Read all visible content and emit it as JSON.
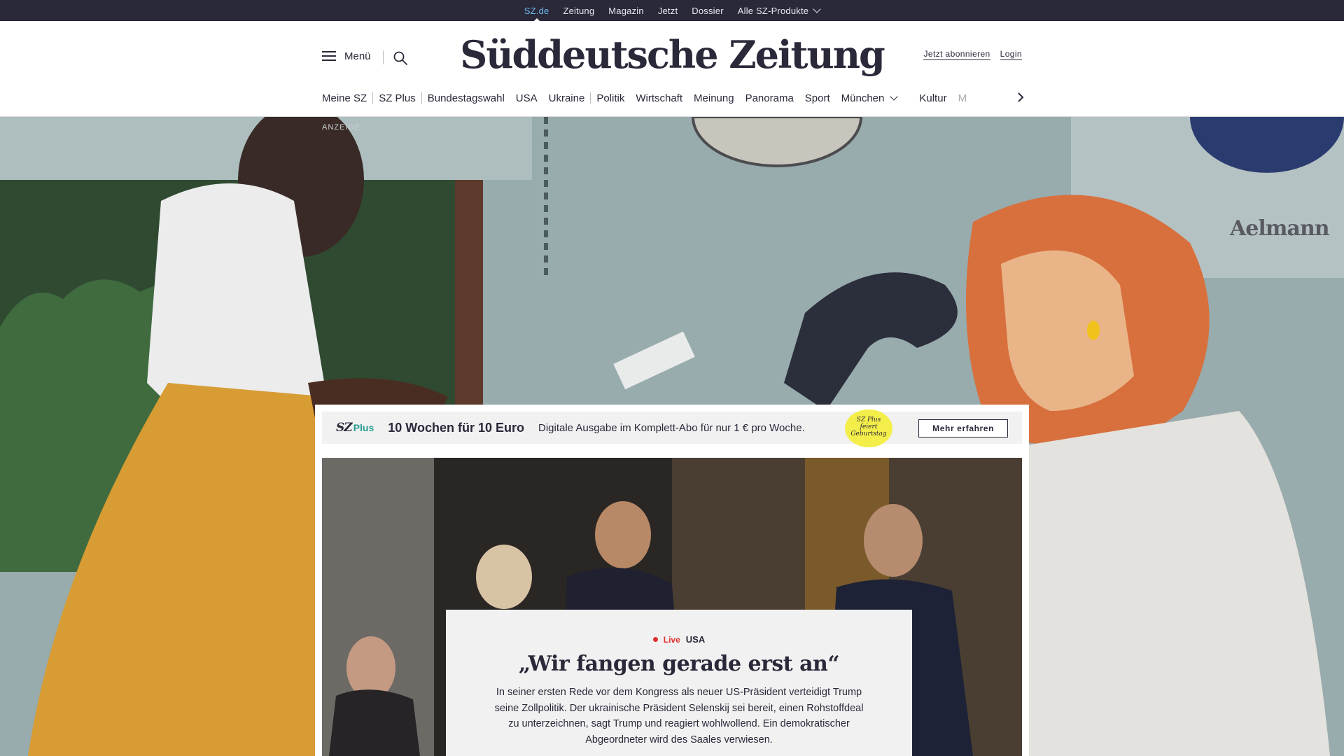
{
  "topbar": {
    "links": [
      "SZ.de",
      "Zeitung",
      "Magazin",
      "Jetzt",
      "Dossier"
    ],
    "products_label": "Alle SZ-Produkte"
  },
  "header": {
    "menu_label": "Menü",
    "logo_text": "Süddeutsche Zeitung",
    "subscribe_label": "Jetzt abonnieren",
    "login_label": "Login"
  },
  "nav": {
    "items": [
      "Meine SZ",
      "SZ Plus",
      "Bundestagswahl",
      "USA",
      "Ukraine",
      "Politik",
      "Wirtschaft",
      "Meinung",
      "Panorama",
      "Sport",
      "München",
      "Kultur",
      "M"
    ]
  },
  "ad": {
    "label": "ANZEIGE",
    "brand": "Aelmann"
  },
  "promo": {
    "logo_sz": "SZ",
    "logo_plus": "Plus",
    "headline": "10 Wochen für 10 Euro",
    "text": "Digitale Ausgabe im Komplett-Abo für nur 1 € pro Woche.",
    "badge_line1": "SZ Plus",
    "badge_line2": "feiert",
    "badge_line3": "Geburtstag",
    "button_label": "Mehr erfahren"
  },
  "teaser": {
    "live_label": "Live",
    "topic": "USA",
    "title": "„Wir fangen gerade erst an“",
    "text": "In seiner ersten Rede vor dem Kongress als neuer US-Präsident verteidigt Trump seine Zollpolitik. Der ukrainische Präsident Selenskij sei bereit, einen Rohstoffdeal zu unterzeichnen, sagt Trump und reagiert wohlwollend. Ein demokratischer Abgeordneter wird des Saales verwiesen."
  },
  "colors": {
    "topbar_bg": "#29293a",
    "active_link": "#6fb8ee",
    "sz_plus_green": "#2a9d8f",
    "badge_yellow": "#f4ee4a",
    "live_red": "#e03030"
  }
}
